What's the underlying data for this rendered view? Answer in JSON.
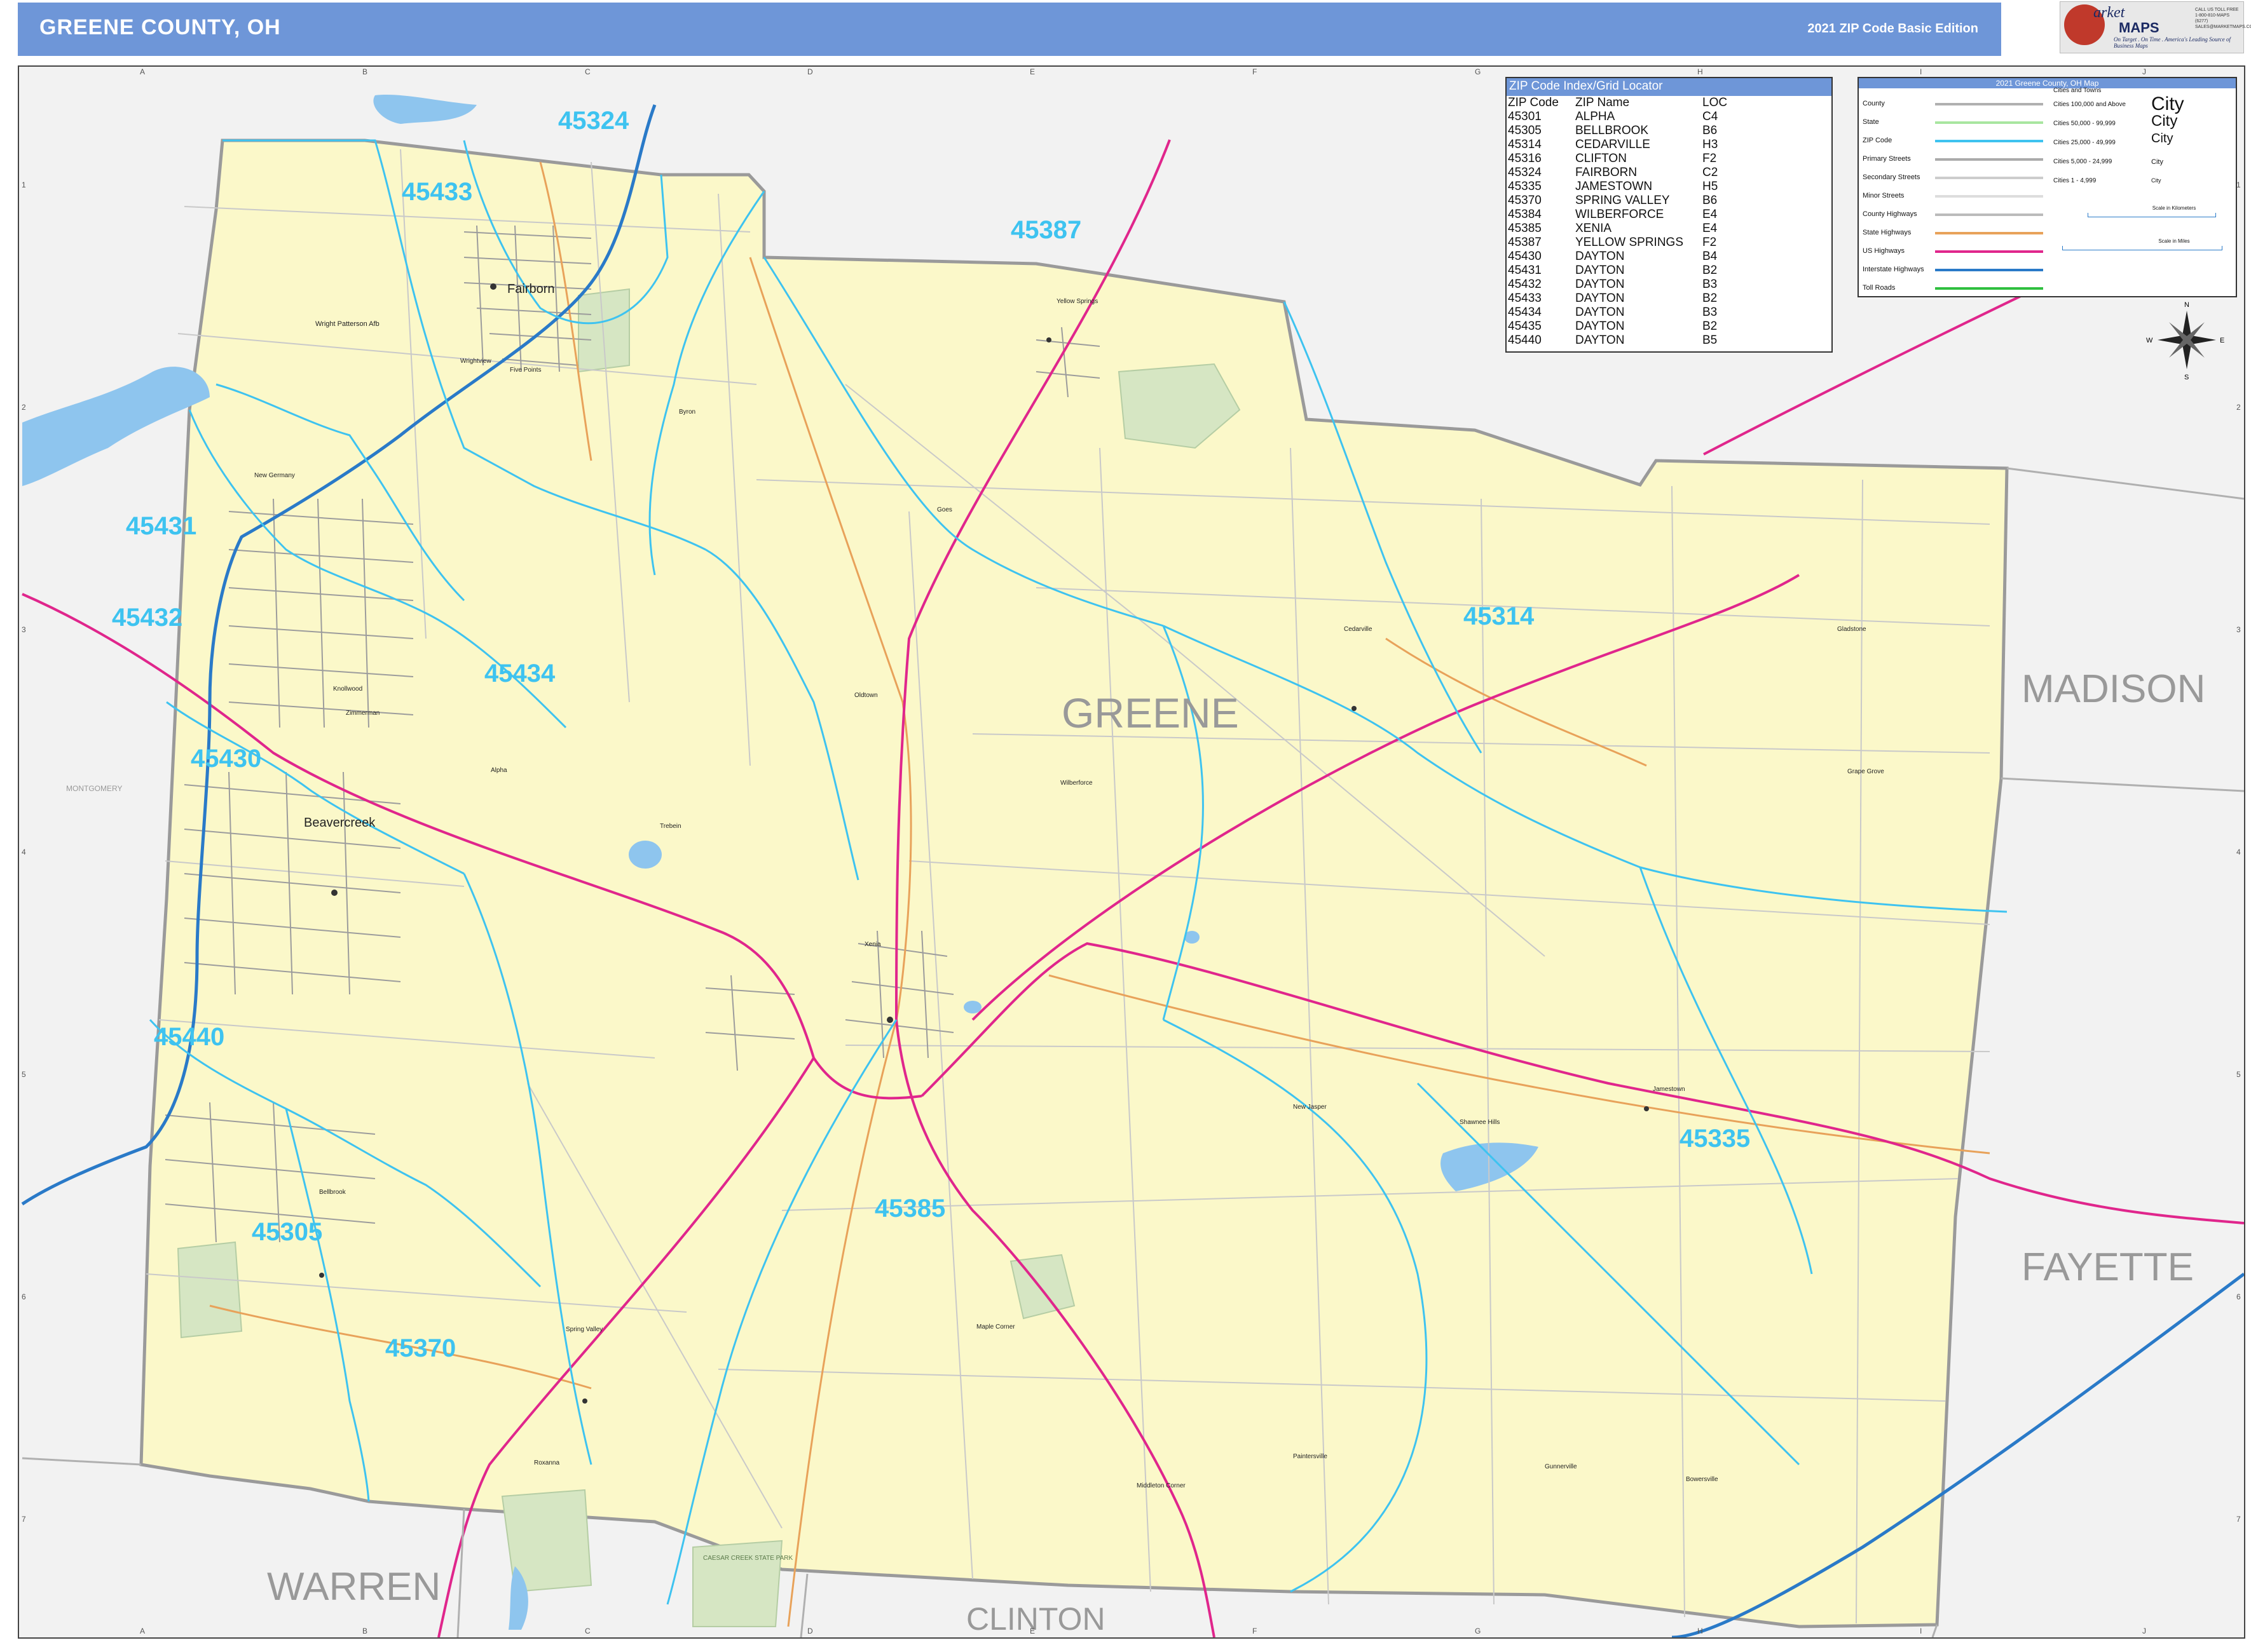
{
  "header": {
    "title": "GREENE COUNTY, OH",
    "edition": "2021 ZIP Code Basic Edition"
  },
  "logo": {
    "top": "arket",
    "bottom": "MAPS",
    "tagline": "On Target . On Time . America's Leading Source of Business Maps",
    "contact": "CALL US TOLL FREE 1-800-810-MAPS (6277) SALES@MARKETMAPS.COM"
  },
  "grid": {
    "columns": [
      "A",
      "B",
      "C",
      "D",
      "E",
      "F",
      "G",
      "H",
      "I",
      "J"
    ],
    "rows": [
      "1",
      "2",
      "3",
      "4",
      "5",
      "6",
      "7"
    ]
  },
  "county_names": {
    "greene": "GREENE",
    "madison": "MADISON",
    "fayette": "FAYETTE",
    "warren": "WARREN",
    "clinton": "CLINTON",
    "montgomery": "MONTGOMERY"
  },
  "zip_labels": [
    "45324",
    "45433",
    "45387",
    "45431",
    "45432",
    "45434",
    "45314",
    "45430",
    "45440",
    "45305",
    "45385",
    "45335",
    "45370"
  ],
  "places": {
    "fairborn": "Fairborn",
    "beavercreek": "Beavercreek",
    "wright_patterson": "Wright Patterson Afb",
    "yellow_springs": "Yellow Springs",
    "byron": "Byron",
    "new_germany": "New Germany",
    "wrightview": "Wrightview",
    "five_points": "Five Points",
    "goes": "Goes",
    "cedarville": "Cedarville",
    "gladstone": "Gladstone",
    "oldtown": "Oldtown",
    "knollwood": "Knollwood",
    "zimmerman": "Zimmerman",
    "alpha": "Alpha",
    "trebein": "Trebein",
    "wilberforce": "Wilberforce",
    "grape_grove": "Grape Grove",
    "xenia": "Xenia",
    "new_jasper": "New Jasper",
    "shawnee_hills": "Shawnee Hills",
    "jamestown": "Jamestown",
    "bellbrook": "Bellbrook",
    "spring_valley": "Spring Valley",
    "maple_corner": "Maple Corner",
    "paintersville": "Paintersville",
    "middleton_corner": "Middleton Corner",
    "gunnerville": "Gunnerville",
    "bowersville": "Bowersville",
    "roxanna": "Roxanna",
    "caesar_creek": "CAESAR CREEK STATE PARK"
  },
  "zip_index": {
    "title": "ZIP Code Index/Grid Locator",
    "headers": [
      "ZIP Code",
      "ZIP Name",
      "LOC"
    ],
    "rows": [
      [
        "45301",
        "ALPHA",
        "C4"
      ],
      [
        "45305",
        "BELLBROOK",
        "B6"
      ],
      [
        "45314",
        "CEDARVILLE",
        "H3"
      ],
      [
        "45316",
        "CLIFTON",
        "F2"
      ],
      [
        "45324",
        "FAIRBORN",
        "C2"
      ],
      [
        "45335",
        "JAMESTOWN",
        "H5"
      ],
      [
        "45370",
        "SPRING VALLEY",
        "B6"
      ],
      [
        "45384",
        "WILBERFORCE",
        "E4"
      ],
      [
        "45385",
        "XENIA",
        "E4"
      ],
      [
        "45387",
        "YELLOW SPRINGS",
        "F2"
      ],
      [
        "45430",
        "DAYTON",
        "B4"
      ],
      [
        "45431",
        "DAYTON",
        "B2"
      ],
      [
        "45432",
        "DAYTON",
        "B3"
      ],
      [
        "45433",
        "DAYTON",
        "B2"
      ],
      [
        "45434",
        "DAYTON",
        "B3"
      ],
      [
        "45435",
        "DAYTON",
        "B2"
      ],
      [
        "45440",
        "DAYTON",
        "B5"
      ]
    ]
  },
  "legend": {
    "title": "2021 Greene County, OH Map",
    "items": [
      {
        "label": "County",
        "color": "#b0b0b0"
      },
      {
        "label": "State",
        "color": "#a8e6a0"
      },
      {
        "label": "ZIP Code",
        "color": "#3ec3f0"
      },
      {
        "label": "Primary Streets",
        "color": "#aaaaaa"
      },
      {
        "label": "Secondary Streets",
        "color": "#cccccc"
      },
      {
        "label": "Minor Streets",
        "color": "#dddddd"
      },
      {
        "label": "County Highways",
        "color": "#bbbbbb"
      },
      {
        "label": "State Highways",
        "color": "#e8a25a"
      },
      {
        "label": "US Highways",
        "color": "#e0268c"
      },
      {
        "label": "Interstate Highways",
        "color": "#2a7ac8"
      },
      {
        "label": "Toll Roads",
        "color": "#2fbf3f"
      }
    ],
    "cities_heading": "Cities and Towns",
    "cities": [
      "Cities 100,000 and Above",
      "Cities 50,000 - 99,999",
      "Cities 25,000 - 49,999",
      "Cities 5,000 - 24,999",
      "Cities 1 - 4,999"
    ],
    "city_samples": [
      "City",
      "City",
      "City",
      "City",
      "City"
    ],
    "scale_km": "Scale in Kilometers",
    "scale_mi": "Scale in Miles"
  },
  "compass": {
    "n": "N",
    "s": "S",
    "e": "E",
    "w": "W"
  },
  "colors": {
    "header": "#6e96d8",
    "county_fill": "#fbf8c9",
    "outside_fill": "#f2f2f2",
    "zip_boundary": "#3ec3f0",
    "zip_label": "#3ec3f0",
    "us_highway": "#e0268c",
    "interstate": "#2a7ac8",
    "state_highway": "#e8a25a",
    "water": "#8ec5ee",
    "park": "#d6e6c3",
    "county_label": "#999999"
  }
}
